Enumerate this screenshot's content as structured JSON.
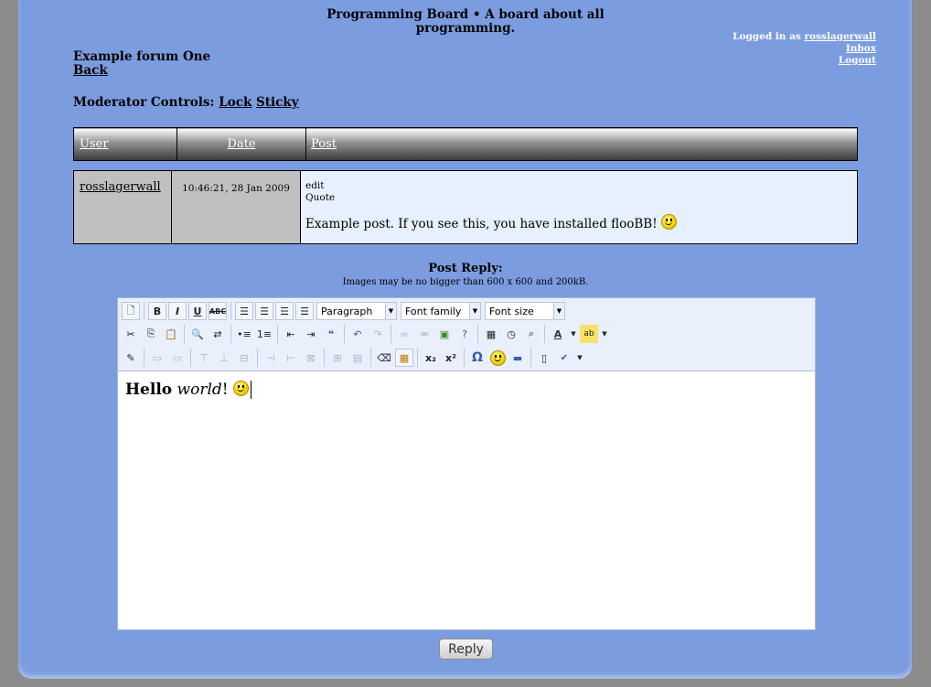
{
  "board": {
    "title_line1": "Programming Board • A board about all",
    "title_line2": "programming."
  },
  "user_panel": {
    "logged_in_prefix": "Logged in as",
    "username": "rosslagerwall",
    "inbox": "Inbox",
    "logout": "Logout"
  },
  "forum": {
    "name": "Example forum One",
    "back": "Back"
  },
  "moderator": {
    "label": "Moderator Controls:",
    "lock": "Lock",
    "sticky": "Sticky"
  },
  "table": {
    "headers": [
      "User",
      "Date",
      "Post"
    ],
    "post": {
      "user": "rosslagerwall",
      "date": "10:46:21, 28 Jan 2009",
      "edit": "edit",
      "quote": "Quote",
      "text": "Example post. If you see this, you have installed flooBB!"
    }
  },
  "reply": {
    "title": "Post Reply:",
    "note": "Images may be no bigger than 600 x 600 and 200kB.",
    "button": "Reply"
  },
  "editor": {
    "format_select": "Paragraph",
    "font_family_select": "Font family",
    "font_size_select": "Font size",
    "content_bold": "Hello",
    "content_italic": "world",
    "content_tail": "!"
  },
  "icons": {
    "row1": [
      "new-document-icon",
      "bold-icon",
      "italic-icon",
      "underline-icon",
      "strikethrough-icon",
      "align-left-icon",
      "align-center-icon",
      "align-right-icon",
      "align-justify-icon"
    ],
    "row2": [
      "cut-icon",
      "copy-icon",
      "paste-icon",
      "find-icon",
      "replace-icon",
      "bullet-list-icon",
      "numbered-list-icon",
      "outdent-icon",
      "indent-icon",
      "blockquote-icon",
      "undo-icon",
      "redo-icon",
      "link-icon",
      "unlink-icon",
      "image-icon",
      "help-icon",
      "insert-date-icon",
      "insert-time-icon",
      "preview-icon",
      "text-color-icon",
      "highlight-color-icon"
    ],
    "row3": [
      "edit-html-icon",
      "table-row-icon",
      "table-cell-icon",
      "insert-row-before-icon",
      "insert-row-after-icon",
      "delete-row-icon",
      "insert-col-before-icon",
      "insert-col-after-icon",
      "delete-col-icon",
      "split-cells-icon",
      "merge-cells-icon",
      "eraser-icon",
      "table-icon",
      "subscript-icon",
      "superscript-icon",
      "special-char-icon",
      "emoticon-icon",
      "horizontal-rule-icon",
      "fullscreen-icon",
      "spellcheck-icon"
    ]
  }
}
